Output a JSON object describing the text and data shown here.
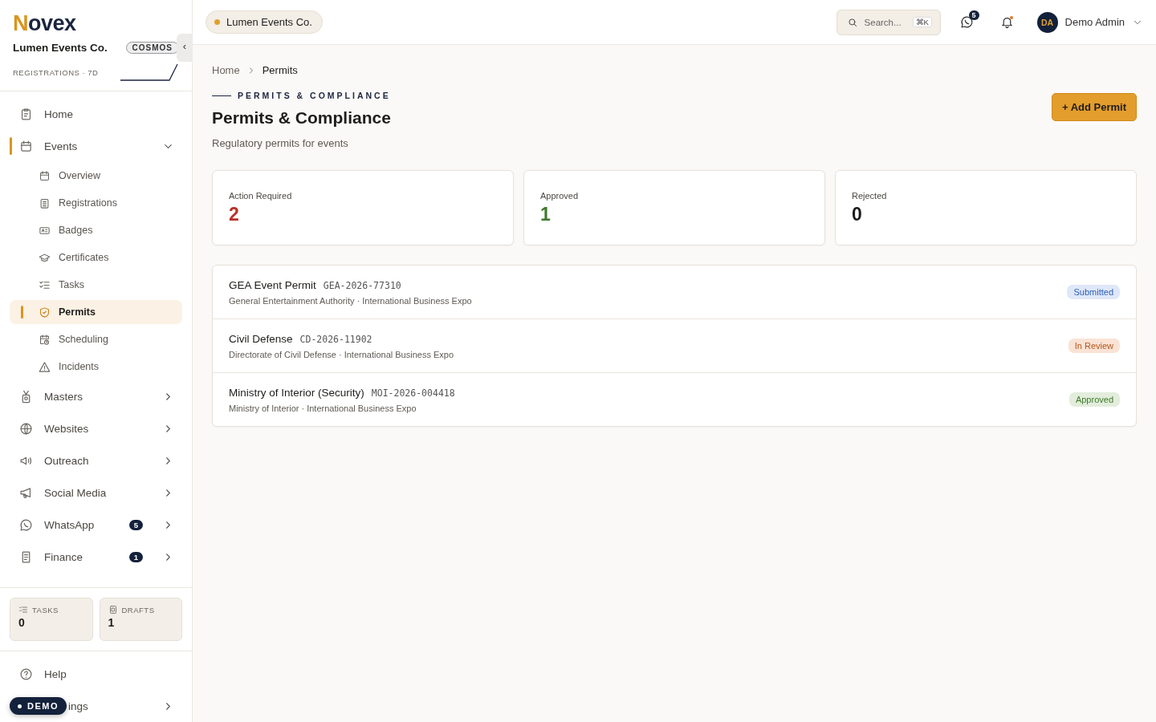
{
  "sidebar": {
    "logo": {
      "initial": "N",
      "rest": "ovex"
    },
    "org": "Lumen Events Co.",
    "plan": "COSMOS",
    "collapse": "‹",
    "sparkline_label": "REGISTRATIONS · 7D",
    "nav": [
      {
        "label": "Home",
        "selected": false
      },
      {
        "label": "Events",
        "selected": true,
        "expanded": true,
        "children": [
          {
            "label": "Overview",
            "selected": false
          },
          {
            "label": "Registrations",
            "selected": false
          },
          {
            "label": "Badges",
            "selected": false
          },
          {
            "label": "Certificates",
            "selected": false
          },
          {
            "label": "Tasks",
            "selected": false
          },
          {
            "label": "Permits",
            "selected": true
          },
          {
            "label": "Scheduling",
            "selected": false
          },
          {
            "label": "Incidents",
            "selected": false
          }
        ]
      },
      {
        "label": "Masters",
        "selected": false,
        "expanded": false
      },
      {
        "label": "Websites",
        "selected": false,
        "expanded": false
      },
      {
        "label": "Outreach",
        "selected": false,
        "expanded": false
      },
      {
        "label": "Social Media",
        "selected": false,
        "expanded": false
      },
      {
        "label": "WhatsApp",
        "selected": false,
        "expanded": false,
        "badge": "5"
      },
      {
        "label": "Finance",
        "selected": false,
        "expanded": false,
        "badge": "1"
      }
    ],
    "counters": [
      {
        "label": "TASKS",
        "value": "0"
      },
      {
        "label": "DRAFTS",
        "value": "1"
      }
    ],
    "footer": [
      {
        "label": "Help"
      },
      {
        "label": "ings",
        "expanded": false
      }
    ],
    "demo_badge": "DEMO"
  },
  "topbar": {
    "org": "Lumen Events Co.",
    "search": {
      "placeholder": "Search...",
      "shortcut": "⌘K"
    },
    "messages_badge": "5",
    "notifications_unread": true,
    "user": {
      "initials": "DA",
      "name": "Demo Admin"
    }
  },
  "breadcrumb": [
    {
      "label": "Home",
      "selected": false
    },
    {
      "label": "Permits",
      "selected": true
    }
  ],
  "header": {
    "eyebrow": "PERMITS & COMPLIANCE",
    "title": "Permits & Compliance",
    "subtitle": "Regulatory permits for events",
    "action": "+ Add Permit"
  },
  "stats": [
    {
      "label": "Action Required",
      "value": "2",
      "color": "#b8322a"
    },
    {
      "label": "Approved",
      "value": "1",
      "color": "#3f7a2a"
    },
    {
      "label": "Rejected",
      "value": "0",
      "color": "#1c1c1c"
    }
  ],
  "permits": [
    {
      "title": "GEA Event Permit",
      "code": "GEA-2026-77310",
      "subtitle": "General Entertainment Authority · International Business Expo",
      "status": "Submitted",
      "kind": "submitted"
    },
    {
      "title": "Civil Defense",
      "code": "CD-2026-11902",
      "subtitle": "Directorate of Civil Defense · International Business Expo",
      "status": "In Review",
      "kind": "review"
    },
    {
      "title": "Ministry of Interior (Security)",
      "code": "MOI-2026-004418",
      "subtitle": "Ministry of Interior · International Business Expo",
      "status": "Approved",
      "kind": "approved"
    }
  ]
}
